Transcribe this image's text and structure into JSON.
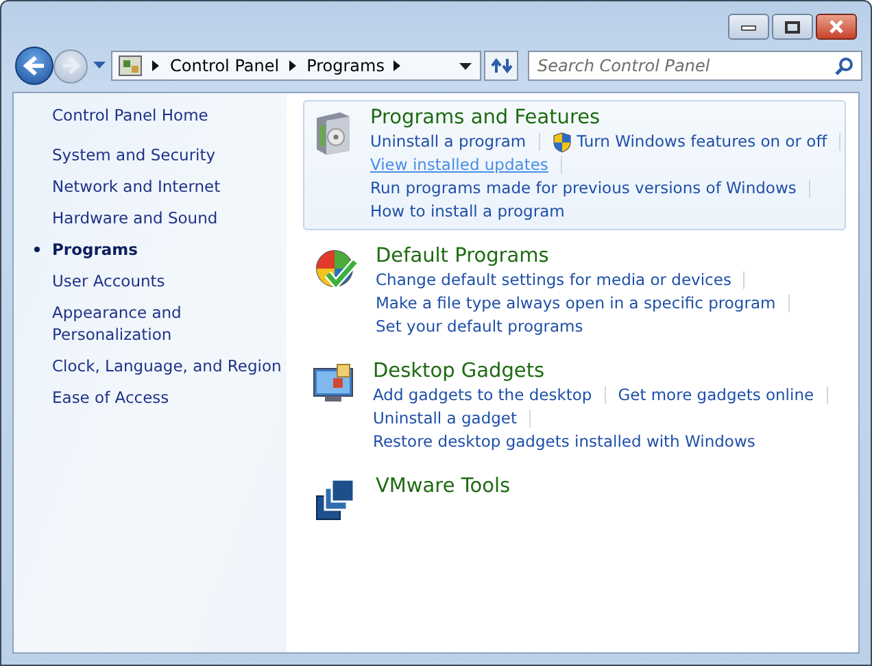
{
  "address_bar": {
    "crumbs": [
      "Control Panel",
      "Programs"
    ]
  },
  "search": {
    "placeholder": "Search Control Panel"
  },
  "sidebar": {
    "home": "Control Panel Home",
    "items": [
      {
        "label": "System and Security",
        "selected": false
      },
      {
        "label": "Network and Internet",
        "selected": false
      },
      {
        "label": "Hardware and Sound",
        "selected": false
      },
      {
        "label": "Programs",
        "selected": true
      },
      {
        "label": "User Accounts",
        "selected": false
      },
      {
        "label": "Appearance and Personalization",
        "selected": false
      },
      {
        "label": "Clock, Language, and Region",
        "selected": false
      },
      {
        "label": "Ease of Access",
        "selected": false
      }
    ]
  },
  "sections": [
    {
      "kind": "programs",
      "title": "Programs and Features",
      "selected": true,
      "lines": [
        [
          {
            "label": "Uninstall a program",
            "kind": "plain",
            "hovered": false
          },
          {
            "label": "Turn Windows features on or off",
            "kind": "shield",
            "hovered": false
          }
        ],
        [
          {
            "label": "View installed updates",
            "kind": "plain",
            "hovered": true
          }
        ],
        [
          {
            "label": "Run programs made for previous versions of Windows",
            "kind": "plain",
            "hovered": false
          }
        ],
        [
          {
            "label": "How to install a program",
            "kind": "plain",
            "hovered": false
          }
        ]
      ]
    },
    {
      "kind": "defaults",
      "title": "Default Programs",
      "selected": false,
      "lines": [
        [
          {
            "label": "Change default settings for media or devices",
            "kind": "plain",
            "hovered": false
          }
        ],
        [
          {
            "label": "Make a file type always open in a specific program",
            "kind": "plain",
            "hovered": false
          }
        ],
        [
          {
            "label": "Set your default programs",
            "kind": "plain",
            "hovered": false
          }
        ]
      ]
    },
    {
      "kind": "gadgets",
      "title": "Desktop Gadgets",
      "selected": false,
      "lines": [
        [
          {
            "label": "Add gadgets to the desktop",
            "kind": "plain",
            "hovered": false
          },
          {
            "label": "Get more gadgets online",
            "kind": "plain",
            "hovered": false
          }
        ],
        [
          {
            "label": "Uninstall a gadget",
            "kind": "plain",
            "hovered": false
          }
        ],
        [
          {
            "label": "Restore desktop gadgets installed with Windows",
            "kind": "plain",
            "hovered": false
          }
        ]
      ]
    },
    {
      "kind": "vmware",
      "title": "VMware Tools",
      "selected": false
    }
  ]
}
